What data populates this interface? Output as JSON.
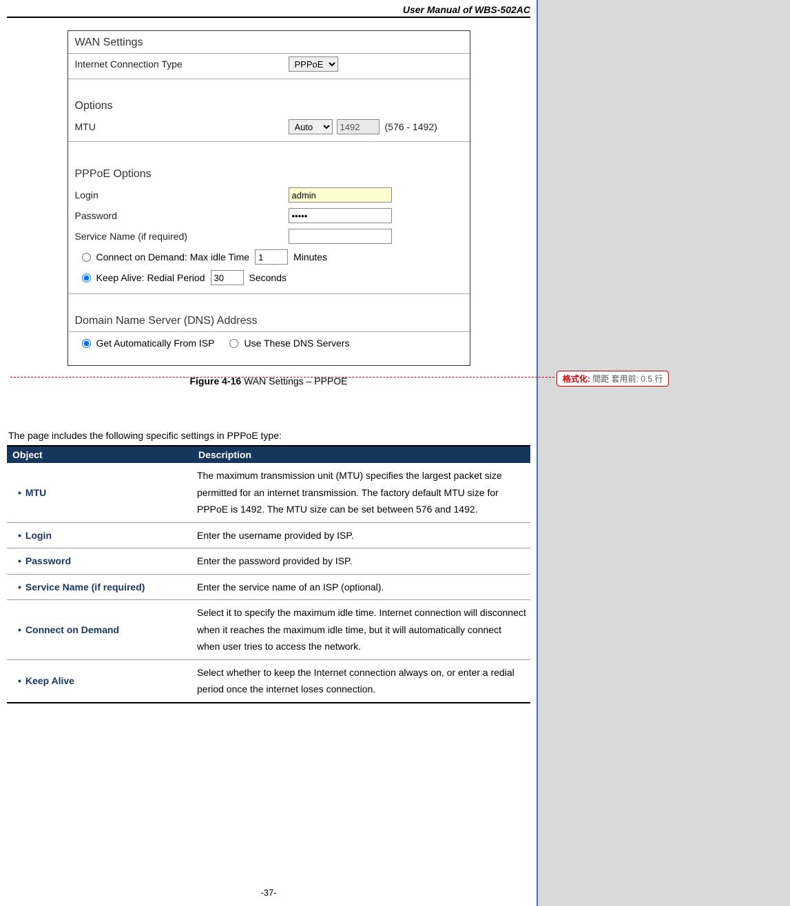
{
  "doc": {
    "header_title": "User  Manual  of  WBS-502AC",
    "page_number": "-37-"
  },
  "screenshot": {
    "wan_settings_title": "WAN Settings",
    "internet_conn_label": "Internet Connection Type",
    "internet_conn_value": "PPPoE",
    "options_label": "Options",
    "mtu_label": "MTU",
    "mtu_mode": "Auto",
    "mtu_value": "1492",
    "mtu_range": "(576 - 1492)",
    "pppoe_options_label": "PPPoE Options",
    "login_label": "Login",
    "login_value": "admin",
    "password_label": "Password",
    "password_value": "•••••",
    "service_label": "Service Name (if required)",
    "service_value": "",
    "cod_label_prefix": "Connect on Demand:  Max idle Time",
    "cod_value": "1",
    "cod_suffix": "Minutes",
    "ka_label_prefix": "Keep Alive:  Redial Period",
    "ka_value": "30",
    "ka_suffix": "Seconds",
    "dns_title": "Domain Name Server (DNS) Address",
    "dns_opt1": "Get Automatically From ISP",
    "dns_opt2": "Use These DNS Servers"
  },
  "caption": {
    "number": "Figure 4-16",
    "text": " WAN Settings – PPPOE"
  },
  "comment": {
    "label": "格式化:",
    "text": " 間距 套用前:  0.5 行"
  },
  "intro": "The page includes the following specific settings in PPPoE type:",
  "table": {
    "h1": "Object",
    "h2": "Description",
    "rows": [
      {
        "obj": "MTU",
        "desc": "The maximum transmission unit (MTU) specifies the largest packet size permitted for an internet transmission. The factory default MTU size for PPPoE is 1492. The MTU size can be set between 576 and 1492."
      },
      {
        "obj": "Login",
        "desc": "Enter the username provided by ISP."
      },
      {
        "obj": "Password",
        "desc": "Enter the password provided by ISP."
      },
      {
        "obj": "Service Name (if required)",
        "desc": "Enter the service name of an ISP (optional)."
      },
      {
        "obj": "Connect on Demand",
        "desc": "Select it to specify the maximum idle time. Internet connection will disconnect when it reaches the maximum idle time, but it will automatically connect when user tries to access the network."
      },
      {
        "obj": "Keep Alive",
        "desc": "Select whether to keep the Internet connection always on, or enter a redial period once the internet loses connection."
      }
    ]
  }
}
